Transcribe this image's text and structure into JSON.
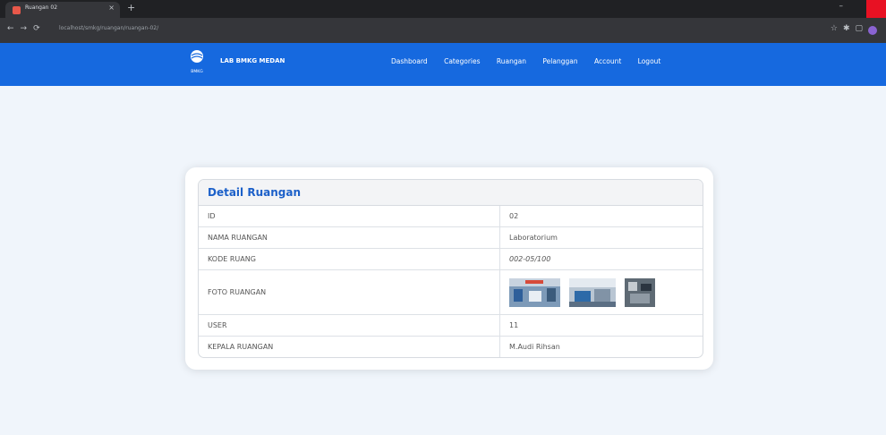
{
  "browser": {
    "tab_title": "Ruangan 02",
    "new_tab": "+",
    "url": "localhost/smkg/ruangan/ruangan-02/"
  },
  "site": {
    "brand": "LAB BMKG MEDAN",
    "logo_text": "BMKG",
    "menu": [
      "Dashboard",
      "Categories",
      "Ruangan",
      "Pelanggan",
      "Account",
      "Logout"
    ]
  },
  "detail": {
    "title": "Detail Ruangan",
    "rows": [
      {
        "label": "ID",
        "value": "02"
      },
      {
        "label": "NAMA RUANGAN",
        "value": "Laboratorium"
      },
      {
        "label": "KODE RUANG",
        "value": "002-05/100"
      },
      {
        "label": "FOTO RUANGAN",
        "value": ""
      },
      {
        "label": "USER",
        "value": "11"
      },
      {
        "label": "KEPALA RUANGAN",
        "value": "M.Audi Rihsan"
      }
    ]
  },
  "colors": {
    "navbar": "#1669df",
    "page_bg": "#f0f5fb",
    "title": "#1c60c9"
  }
}
